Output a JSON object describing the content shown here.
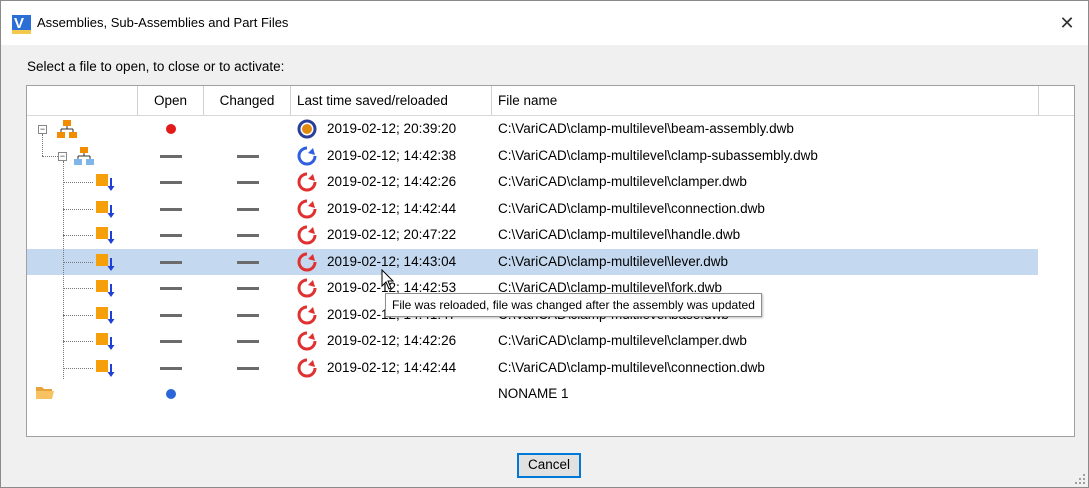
{
  "window": {
    "title": "Assemblies, Sub-Assemblies and Part Files",
    "close_glyph": "✕",
    "app_icon_letter": "V"
  },
  "instruction": "Select a file to open, to close or to activate:",
  "columns": {
    "open": "Open",
    "changed": "Changed",
    "last_saved": "Last time saved/reloaded",
    "file_name": "File name"
  },
  "rows": [
    {
      "icon": "assembly-icon",
      "open": "red-dot",
      "changed": "",
      "status": "saved-current",
      "date": "2019-02-12; 20:39:20",
      "file": "C:\\VariCAD\\clamp-multilevel\\beam-assembly.dwb"
    },
    {
      "icon": "subassembly-icon",
      "open": "dash",
      "changed": "dash",
      "status": "reload-blue",
      "date": "2019-02-12; 14:42:38",
      "file": "C:\\VariCAD\\clamp-multilevel\\clamp-subassembly.dwb"
    },
    {
      "icon": "part-icon",
      "open": "dash",
      "changed": "dash",
      "status": "reload-red",
      "date": "2019-02-12; 14:42:26",
      "file": "C:\\VariCAD\\clamp-multilevel\\clamper.dwb"
    },
    {
      "icon": "part-icon",
      "open": "dash",
      "changed": "dash",
      "status": "reload-red",
      "date": "2019-02-12; 14:42:44",
      "file": "C:\\VariCAD\\clamp-multilevel\\connection.dwb"
    },
    {
      "icon": "part-icon",
      "open": "dash",
      "changed": "dash",
      "status": "reload-red",
      "date": "2019-02-12; 20:47:22",
      "file": "C:\\VariCAD\\clamp-multilevel\\handle.dwb"
    },
    {
      "icon": "part-icon",
      "open": "dash",
      "changed": "dash",
      "status": "reload-red",
      "date": "2019-02-12; 14:43:04",
      "file": "C:\\VariCAD\\clamp-multilevel\\lever.dwb"
    },
    {
      "icon": "part-icon",
      "open": "dash",
      "changed": "dash",
      "status": "reload-red",
      "date": "2019-02-12; 14:42:53",
      "file": "C:\\VariCAD\\clamp-multilevel\\fork.dwb"
    },
    {
      "icon": "part-icon",
      "open": "dash",
      "changed": "dash",
      "status": "reload-red",
      "date": "2019-02-12; 14:41:47",
      "file": "C:\\VariCAD\\clamp-multilevel\\base.dwb"
    },
    {
      "icon": "part-icon",
      "open": "dash",
      "changed": "dash",
      "status": "reload-red",
      "date": "2019-02-12; 14:42:26",
      "file": "C:\\VariCAD\\clamp-multilevel\\clamper.dwb"
    },
    {
      "icon": "part-icon",
      "open": "dash",
      "changed": "dash",
      "status": "reload-red",
      "date": "2019-02-12; 14:42:44",
      "file": "C:\\VariCAD\\clamp-multilevel\\connection.dwb"
    },
    {
      "icon": "folder-icon",
      "open": "blue-dot",
      "changed": "",
      "status": "",
      "date": "",
      "file": "NONAME 1"
    }
  ],
  "selected_row_index": 5,
  "tooltip": "File was reloaded, file was changed after the assembly was updated",
  "cancel_label": "Cancel",
  "colors": {
    "selection": "#c4d9ef",
    "accent": "#0078d7",
    "assembly_orange": "#f28c00",
    "subassembly_blue": "#7fb5e8",
    "part_orange": "#f5a00a",
    "arrow_blue": "#1f3fd6",
    "reload_red": "#e03030",
    "reload_blue": "#3060e0",
    "open_red": "#e21a1a",
    "open_blue": "#2a66d8"
  }
}
